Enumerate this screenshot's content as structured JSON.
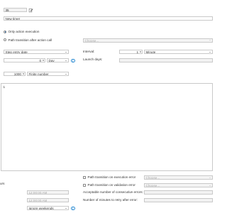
{
  "header": {
    "id_value": "35",
    "name_value": "New timer"
  },
  "execution": {
    "option_action": "Only action execution",
    "option_path": "Path transition after action call",
    "choose_placeholder": "Choose..."
  },
  "schedule": {
    "start_type": "Step entry date",
    "offset_value": "0",
    "offset_unit": "Day",
    "interval_label": "Interval:",
    "interval_value": "1",
    "interval_unit": "Minute",
    "launch_days_label": "Launch days:",
    "launch_days_value": ""
  },
  "repeat": {
    "count_value": "1000",
    "mode": "Finite number"
  },
  "script": {
    "line_number": "1"
  },
  "bottom": {
    "left_fragment": "urs",
    "time_from": "12:00:00 AM",
    "time_to": "12:00:00 AM",
    "weekends": "Ignore weekends",
    "path_on_exec_error": "Path transition on execution error",
    "path_on_validation_error": "Path transition on validation error",
    "choose_placeholder_1": "Choose...",
    "choose_placeholder_2": "Choose...",
    "consecutive_errors_label": "Acceptable number of consecutive errors:",
    "retry_minutes_label": "Number of minutes to retry after error:",
    "consecutive_errors_value": "",
    "retry_minutes_value": ""
  },
  "colors": {
    "accent": "#2a8bd2",
    "border": "#c9c9c9"
  }
}
